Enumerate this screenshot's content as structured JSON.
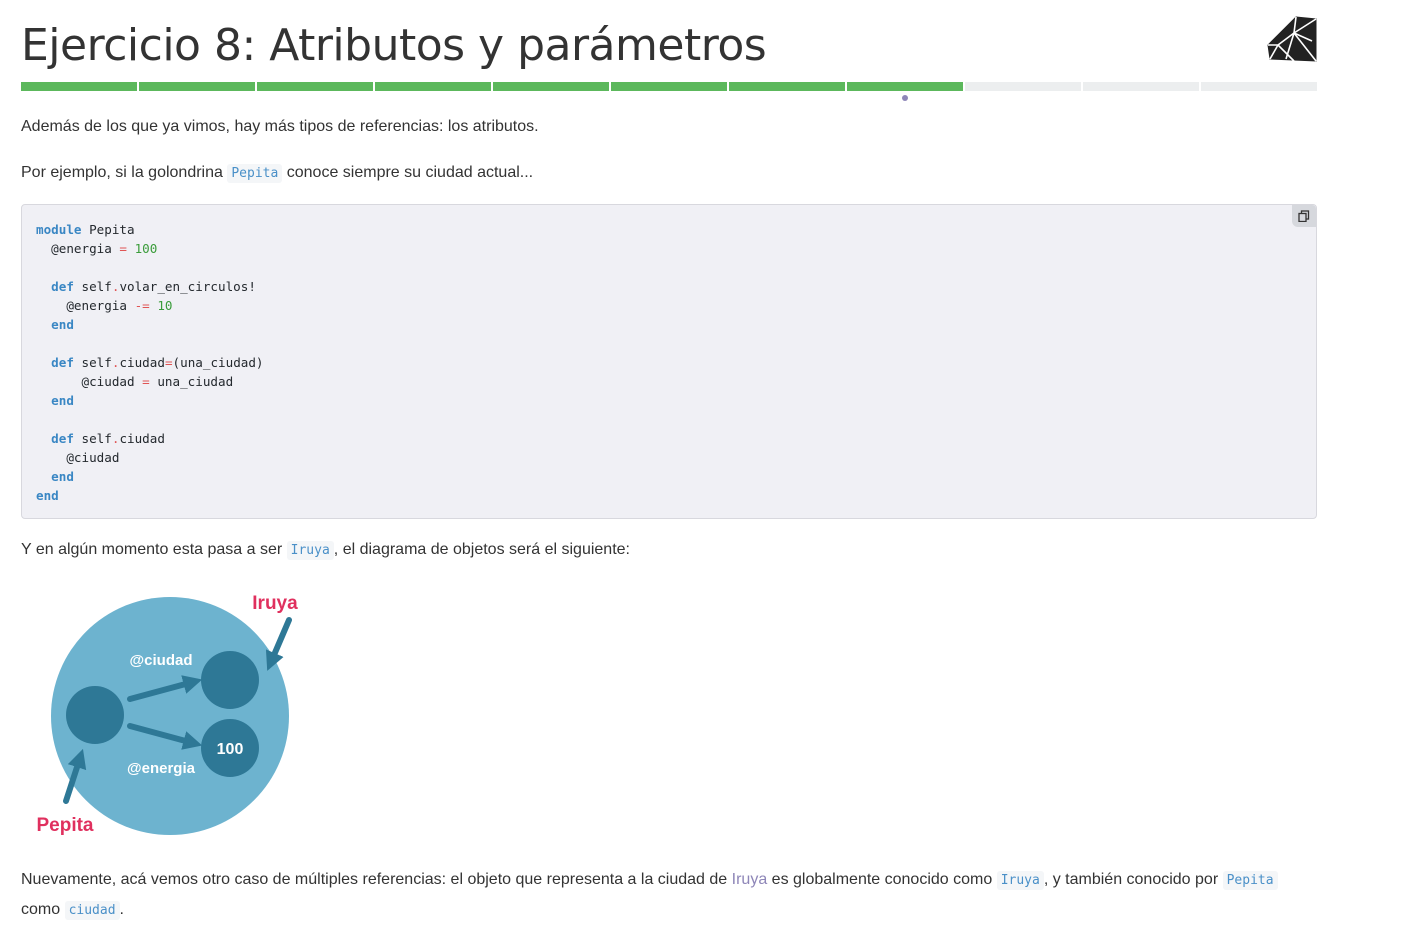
{
  "header": {
    "title": "Ejercicio 8: Atributos y parámetros",
    "logo_icon": "ruby-gem-icon"
  },
  "progress": {
    "total_steps": 11,
    "completed_steps": 8,
    "current_step": 8,
    "done_color": "#5cb85c",
    "todo_color": "#eceeef"
  },
  "content": {
    "intro": "Además de los que ya vimos, hay más tipos de referencias: los atributos.",
    "example_before": "Por ejemplo, si la golondrina ",
    "example_code": "Pepita",
    "example_after": " conoce siempre su ciudad actual...",
    "copy_icon": "copy-icon",
    "transition_before": "Y en algún momento esta pasa a ser ",
    "transition_code": "Iruya",
    "transition_after": ", el diagrama de objetos será el siguiente:",
    "conclusion_part1": "Nuevamente, acá vemos otro caso de múltiples referencias: el objeto que representa a la ciudad de ",
    "conclusion_link": "Iruya",
    "conclusion_part2": " es globalmente conocido como ",
    "conclusion_code1": "Iruya",
    "conclusion_part3": ", y también conocido por ",
    "conclusion_code2": "Pepita",
    "conclusion_line2_before": "como ",
    "conclusion_code3": "ciudad",
    "conclusion_line2_after": "."
  },
  "diagram": {
    "label_iruya": "Iruya",
    "label_pepita": "Pepita",
    "label_ciudad": "@ciudad",
    "label_energia": "@energia",
    "value_energia": "100",
    "colors": {
      "outer": "#6db3cf",
      "node": "#2e7896",
      "label": "#e0305e",
      "text": "#ffffff"
    }
  }
}
